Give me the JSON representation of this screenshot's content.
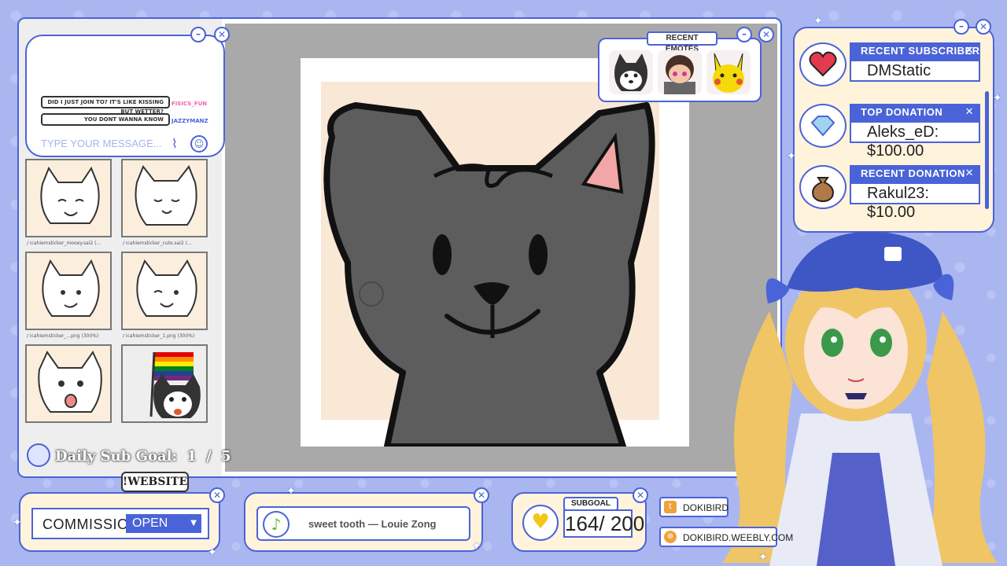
{
  "chat": {
    "messages": [
      {
        "text": "DID I JUST JOIN TO? IT'S LIKE KISSING BUT WETTER?",
        "user": "FISICS_FUN",
        "user_color": "#f064b4"
      },
      {
        "text": "YOU DONT WANNA KNOW",
        "user": "JAZZYMANZ",
        "user_color": "#4b63d8"
      }
    ],
    "placeholder": "TYPE YOUR MESSAGE..."
  },
  "thumbnails": [
    {
      "caption": "/ icahiemsticker_mooey.sai2 (..."
    },
    {
      "caption": "/ icahiemsticker_cute.sai2 (..."
    },
    {
      "caption": "/ icahiemsticker_...png (300%)"
    },
    {
      "caption": "/ icahiemsticker_1.png (300%)"
    }
  ],
  "sub_goal_daily": {
    "label": "Daily Sub Goal:",
    "current": "1",
    "separator": "/",
    "target": "5"
  },
  "website_tag": "!WEBSITE",
  "emotes": {
    "title": "RECENT EMOTES"
  },
  "alerts": [
    {
      "label": "RECENT SUBSCRIBER",
      "value": "DMStatic",
      "icon": "heart-icon"
    },
    {
      "label": "TOP DONATION",
      "value": "Aleks_eD: $100.00",
      "icon": "gem-icon"
    },
    {
      "label": "RECENT DONATION",
      "value": "Rakul23: $10.00",
      "icon": "money-bag-icon"
    }
  ],
  "commissions": {
    "label": "COMMISSIONS",
    "status": "OPEN"
  },
  "now_playing": {
    "track": "sweet tooth — Louie Zong"
  },
  "subgoal": {
    "label": "SUBGOAL",
    "value": "164/ 200"
  },
  "socials": [
    {
      "icon": "twitter-icon",
      "text": "DOKIBIRD"
    },
    {
      "icon": "website-icon",
      "text": "DOKIBIRD.WEEBLY.COM"
    }
  ],
  "colors": {
    "accent": "#4b63d8",
    "panel_bg": "#fff3dc",
    "page_bg": "#aab6ef",
    "canvas_bg": "#a9a9a9"
  }
}
